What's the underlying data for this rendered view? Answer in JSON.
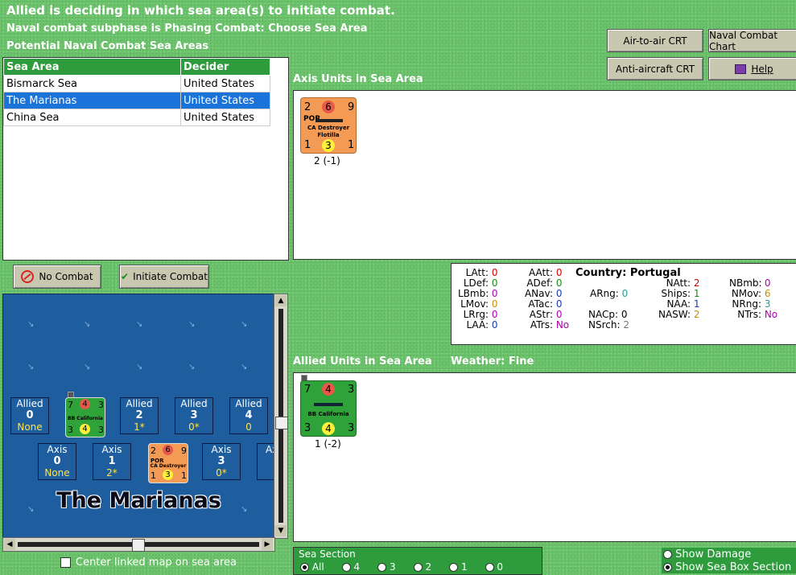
{
  "header": {
    "line1": "Allied is deciding in which sea area(s) to initiate combat.",
    "line2": "Naval combat subphase is Phasing Combat: Choose Sea Area",
    "line3": "Potential Naval Combat Sea Areas"
  },
  "buttons": {
    "air_to_air": "Air-to-air CRT",
    "naval_chart": "Naval Combat Chart",
    "anti_aircraft": "Anti-aircraft CRT",
    "help": "Help",
    "no_combat": "No Combat",
    "initiate_combat": "Initiate Combat"
  },
  "sea_table": {
    "headers": [
      "Sea Area",
      "Decider"
    ],
    "rows": [
      {
        "area": "Bismarck Sea",
        "decider": "United States"
      },
      {
        "area": "The Marianas",
        "decider": "United States"
      },
      {
        "area": "China Sea",
        "decider": "United States"
      }
    ]
  },
  "axis_panel": {
    "title": "Axis Units in Sea Area",
    "unit": {
      "tl": "2",
      "tc": "6",
      "tr": "9",
      "nation": "POR",
      "name1": "CA Destroyer",
      "name2": "Flotilla",
      "bl": "1",
      "bc": "3",
      "br": "1",
      "caption": "2 (-1)"
    }
  },
  "stats": {
    "country_label": "Country:",
    "country": "Portugal",
    "LAtt": "0",
    "LDef": "0",
    "LBmb": "0",
    "LMov": "0",
    "LRrg": "0",
    "LAA": "0",
    "AAtt": "0",
    "ADef": "0",
    "ANav": "0",
    "ATac": "0",
    "AStr": "0",
    "ATrs": "No",
    "ARng": "0",
    "NACp": "0",
    "NSrch": "2",
    "NAtt": "2",
    "Ships": "1",
    "NAA": "1",
    "NASW": "2",
    "NBmb": "0",
    "NMov": "6",
    "NRng": "3",
    "NTrs": "No"
  },
  "allied_panel": {
    "title": "Allied Units in Sea Area",
    "weather_label": "Weather:",
    "weather": "Fine",
    "unit": {
      "tl": "7",
      "tc": "4",
      "tr": "3",
      "name1": "BB California",
      "bl": "3",
      "bc": "4",
      "br": "3",
      "caption": "1 (-2)"
    }
  },
  "map": {
    "sea_name": "The Marianas",
    "allied_boxes": [
      {
        "side": "Allied",
        "num": "0",
        "sub": "None"
      },
      {
        "side": "Allied",
        "num": "2",
        "sub": "1*"
      },
      {
        "side": "Allied",
        "num": "3",
        "sub": "0*"
      },
      {
        "side": "Allied",
        "num": "4",
        "sub": "0"
      }
    ],
    "axis_boxes": [
      {
        "side": "Axis",
        "num": "0",
        "sub": "None"
      },
      {
        "side": "Axis",
        "num": "1",
        "sub": "2*"
      },
      {
        "side": "Axis",
        "num": "3",
        "sub": "0*"
      },
      {
        "side": "Ax",
        "num": "",
        "sub": ""
      }
    ],
    "mini_allied": {
      "tl": "7",
      "tc": "4",
      "tr": "3",
      "name": "BB California",
      "bl": "3",
      "bc": "4",
      "br": "3"
    },
    "mini_axis": {
      "tl": "2",
      "tc": "6",
      "tr": "9",
      "nation": "POR",
      "name": "CA Destroyer",
      "bl": "1",
      "bc": "3",
      "br": "1"
    }
  },
  "center_checkbox": "Center linked map on sea area",
  "sea_section": {
    "label": "Sea Section",
    "options": [
      "All",
      "4",
      "3",
      "2",
      "1",
      "0"
    ],
    "selected": "All"
  },
  "options": {
    "show_damage": "Show Damage",
    "show_sea_box": "Show Sea Box Section"
  },
  "colors": {
    "allied_counter": "#2fa339",
    "axis_counter": "#f39b55",
    "selected_row": "#1a73d9",
    "header_green": "#2e9b3c"
  }
}
